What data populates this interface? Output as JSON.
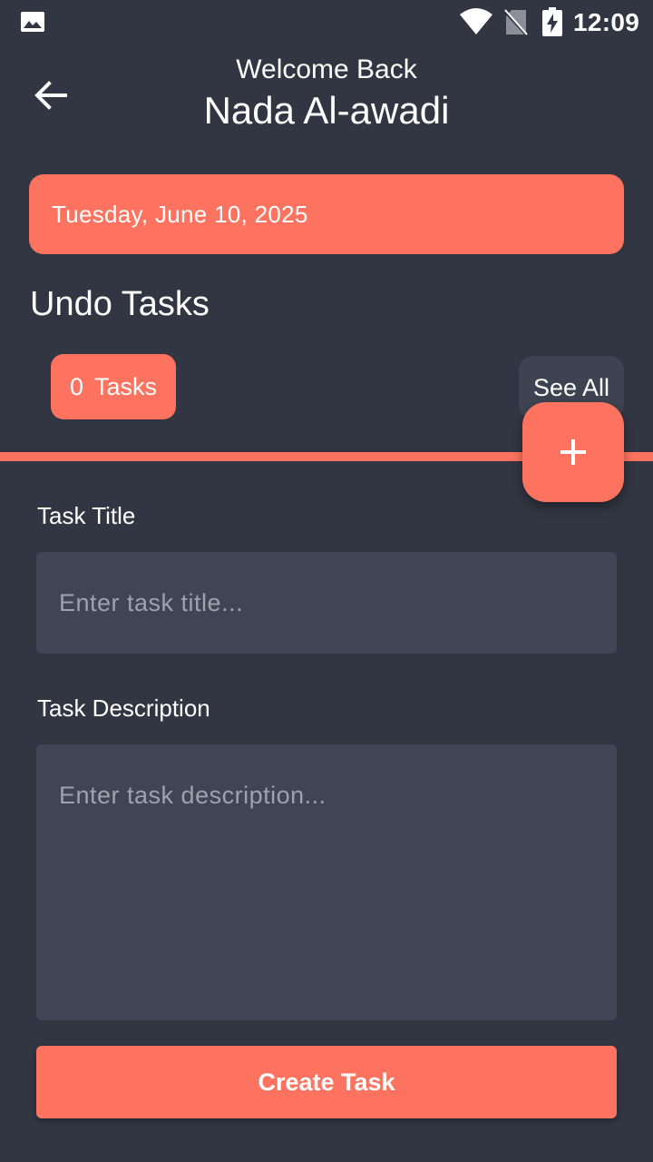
{
  "status_bar": {
    "time": "12:09",
    "icons": [
      "gallery-icon",
      "wifi-icon",
      "no-sim-icon",
      "battery-charging-icon"
    ]
  },
  "header": {
    "back_icon": "arrow-back-icon",
    "subtitle": "Welcome Back",
    "name": "Nada Al-awadi"
  },
  "date_card": {
    "date": "Tuesday, June 10, 2025"
  },
  "tasks_section": {
    "title": "Undo Tasks",
    "count": "0",
    "count_suffix": "Tasks",
    "see_all_label": "See All",
    "fab_icon": "plus-icon"
  },
  "form": {
    "title_label": "Task Title",
    "title_placeholder": "Enter task title...",
    "title_value": "",
    "description_label": "Task Description",
    "description_placeholder": "Enter task description...",
    "description_value": "",
    "submit_label": "Create Task"
  },
  "colors": {
    "background": "#313642",
    "accent": "#fe735f",
    "input_background": "#3f4552",
    "chip_background": "#3d4350"
  }
}
